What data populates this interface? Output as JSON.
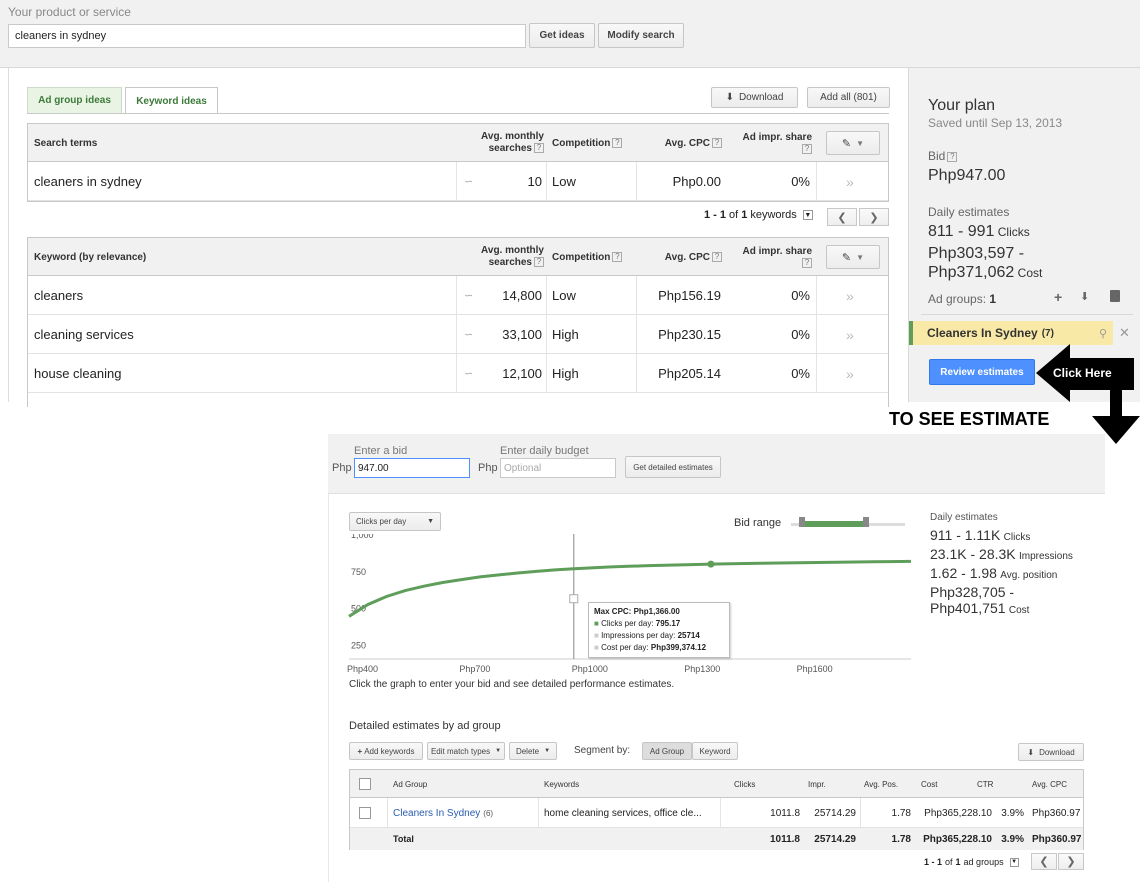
{
  "search": {
    "label": "Your product or service",
    "value": "cleaners in sydney",
    "get_ideas": "Get ideas",
    "modify_search": "Modify search"
  },
  "tabs": {
    "ad_group_ideas": "Ad group ideas",
    "keyword_ideas": "Keyword ideas"
  },
  "toolbar": {
    "download": "Download",
    "add_all": "Add all (801)"
  },
  "columns": {
    "search_terms": "Search terms",
    "keyword_by_relevance": "Keyword (by relevance)",
    "avg_monthly_1": "Avg. monthly",
    "avg_monthly_2": "searches",
    "competition": "Competition",
    "avg_cpc": "Avg. CPC",
    "ad_impr_1": "Ad impr. share",
    "help": "?"
  },
  "search_terms_rows": [
    {
      "term": "cleaners in sydney",
      "searches": "10",
      "competition": "Low",
      "cpc": "Php0.00",
      "share": "0%"
    }
  ],
  "pagination": {
    "range": "1 - 1",
    "of": "of",
    "total": "1",
    "unit": "keywords"
  },
  "keyword_rows": [
    {
      "term": "cleaners",
      "searches": "14,800",
      "competition": "Low",
      "cpc": "Php156.19",
      "share": "0%"
    },
    {
      "term": "cleaning services",
      "searches": "33,100",
      "competition": "High",
      "cpc": "Php230.15",
      "share": "0%"
    },
    {
      "term": "house cleaning",
      "searches": "12,100",
      "competition": "High",
      "cpc": "Php205.14",
      "share": "0%"
    }
  ],
  "plan": {
    "title": "Your plan",
    "saved": "Saved until Sep 13, 2013",
    "bid_label": "Bid",
    "bid_value": "Php947.00",
    "daily_label": "Daily estimates",
    "clicks_range": "811 - 991",
    "clicks_unit": "Clicks",
    "cost_line1": "Php303,597 -",
    "cost_line2": "Php371,062",
    "cost_unit": "Cost",
    "ad_groups_label": "Ad groups:",
    "ad_groups_count": "1",
    "group_name": "Cleaners In Sydney",
    "group_count": "(7)",
    "review_button": "Review estimates"
  },
  "annotation": {
    "click_here": "Click Here",
    "to_see": "TO SEE ESTIMATE"
  },
  "estimate": {
    "bid_label": "Enter a bid",
    "bid_prefix": "Php",
    "bid_value": "947.00",
    "budget_label": "Enter daily budget",
    "budget_prefix": "Php",
    "budget_placeholder": "Optional",
    "get_detailed": "Get detailed estimates",
    "metric_select": "Clicks per day",
    "bid_range": "Bid range",
    "instruction": "Click the graph to enter your bid and see detailed performance estimates.",
    "daily_label": "Daily estimates",
    "clicks": "911 - 1.11K",
    "clicks_unit": "Clicks",
    "impressions": "23.1K - 28.3K",
    "impressions_unit": "Impressions",
    "position": "1.62 - 1.98",
    "position_unit": "Avg. position",
    "cost_line1": "Php328,705 -",
    "cost_line2": "Php401,751",
    "cost_unit": "Cost"
  },
  "tooltip": {
    "max_cpc": "Max CPC: Php1,366.00",
    "clicks_label": "Clicks per day:",
    "clicks_value": "795.17",
    "impr_label": "Impressions per day:",
    "impr_value": "25714",
    "cost_label": "Cost per day:",
    "cost_value": "Php399,374.12"
  },
  "chart_data": {
    "type": "line",
    "title": "",
    "xlabel": "",
    "ylabel": "",
    "x_ticks": [
      "Php400",
      "Php700",
      "Php1000",
      "Php1300",
      "Php1600"
    ],
    "y_ticks": [
      "250",
      "500",
      "750",
      "1,000"
    ],
    "xlim": [
      400,
      1900
    ],
    "ylim": [
      150,
      1000
    ],
    "series": [
      {
        "x": [
          400,
          450,
          500,
          550,
          600,
          650,
          700,
          750,
          800,
          850,
          900,
          950,
          1000,
          1100,
          1200,
          1300,
          1366,
          1400,
          1500,
          1600,
          1700,
          1800,
          1900
        ],
        "y": [
          440,
          520,
          575,
          615,
          645,
          670,
          690,
          708,
          722,
          735,
          746,
          756,
          764,
          776,
          785,
          791,
          795,
          797,
          801,
          805,
          808,
          811,
          814
        ]
      }
    ],
    "marker": {
      "x": 1366,
      "y": 795.17
    },
    "cursor_x": 1000,
    "grid": false
  },
  "detail": {
    "title": "Detailed estimates by ad group",
    "add_keywords": "Add keywords",
    "edit_match": "Edit match types",
    "delete": "Delete",
    "segment_by": "Segment by:",
    "seg_adgroup": "Ad Group",
    "seg_keyword": "Keyword",
    "download": "Download",
    "headers": {
      "ad_group": "Ad Group",
      "keywords": "Keywords",
      "clicks": "Clicks",
      "impr": "Impr.",
      "avg_pos": "Avg. Pos.",
      "cost": "Cost",
      "ctr": "CTR",
      "avg_cpc": "Avg. CPC"
    },
    "row": {
      "ad_group": "Cleaners In Sydney",
      "count": "(6)",
      "keywords": "home cleaning services, office cle...",
      "clicks": "1011.8",
      "impr": "25714.29",
      "avg_pos": "1.78",
      "cost": "Php365,228.10",
      "ctr": "3.9%",
      "avg_cpc": "Php360.97"
    },
    "total": {
      "label": "Total",
      "clicks": "1011.8",
      "impr": "25714.29",
      "avg_pos": "1.78",
      "cost": "Php365,228.10",
      "ctr": "3.9%",
      "avg_cpc": "Php360.97"
    },
    "pagination": {
      "range": "1 - 1",
      "of": "of",
      "total": "1",
      "unit": "ad groups"
    }
  },
  "colors": {
    "accent_green": "#5e9e5a",
    "button_blue": "#4d90fe",
    "plan_yellow": "#f8e9a6"
  },
  "icons": [
    "chart-icon",
    "download-icon",
    "pencil-icon",
    "plus-icon",
    "trash-icon",
    "search-icon",
    "close-icon",
    "chevron-right-icon",
    "arrow-icon"
  ]
}
